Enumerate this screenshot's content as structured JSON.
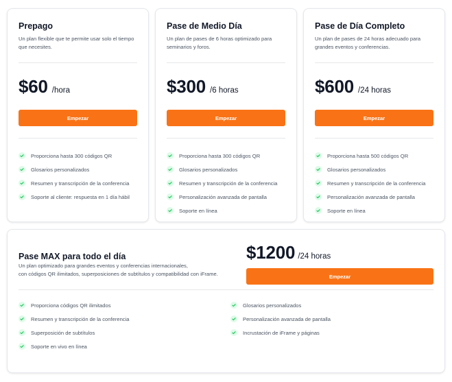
{
  "plans": [
    {
      "title": "Prepago",
      "description": "Un plan flexible que te permite usar solo el tiempo que necesites.",
      "price": "$60",
      "period": "/hora",
      "cta": "Empezar",
      "features": [
        "Proporciona hasta 300 códigos QR",
        "Glosarios personalizados",
        "Resumen y transcripción de la conferencia",
        "Soporte al cliente: respuesta en 1 día hábil"
      ]
    },
    {
      "title": "Pase de Medio Día",
      "description": "Un plan de pases de 6 horas optimizado para seminarios y foros.",
      "price": "$300",
      "period": "/6 horas",
      "cta": "Empezar",
      "features": [
        "Proporciona hasta 300 códigos QR",
        "Glosarios personalizados",
        "Resumen y transcripción de la conferencia",
        "Personalización avanzada de pantalla",
        "Soporte en línea"
      ]
    },
    {
      "title": "Pase de Día Completo",
      "description": "Un plan de pases de 24 horas adecuado para grandes eventos y conferencias.",
      "price": "$600",
      "period": "/24 horas",
      "cta": "Empezar",
      "features": [
        "Proporciona hasta 500 códigos QR",
        "Glosarios personalizados",
        "Resumen y transcripción de la conferencia",
        "Personalización avanzada de pantalla",
        "Soporte en línea"
      ]
    }
  ],
  "max_plan": {
    "title": "Pase MAX para todo el día",
    "description_line1": "Un plan optimizado para grandes eventos y conferencias internacionales,",
    "description_line2": "con códigos QR ilimitados, superposiciones de subtítulos y compatibilidad con iFrame.",
    "price": "$1200",
    "period": "/24 horas",
    "cta": "Empezar",
    "features": [
      "Proporciona códigos QR ilimitados",
      "Glosarios personalizados",
      "Resumen y transcripción de la conferencia",
      "Personalización avanzada de pantalla",
      "Superposición de subtítulos",
      "Incrustación de iFrame y páginas",
      "Soporte en vivo en línea"
    ]
  },
  "colors": {
    "accent": "#f97316",
    "check_bg": "#dcfce7",
    "check_icon": "#22c55e"
  },
  "icons": {
    "feature": "check-circle-icon"
  }
}
